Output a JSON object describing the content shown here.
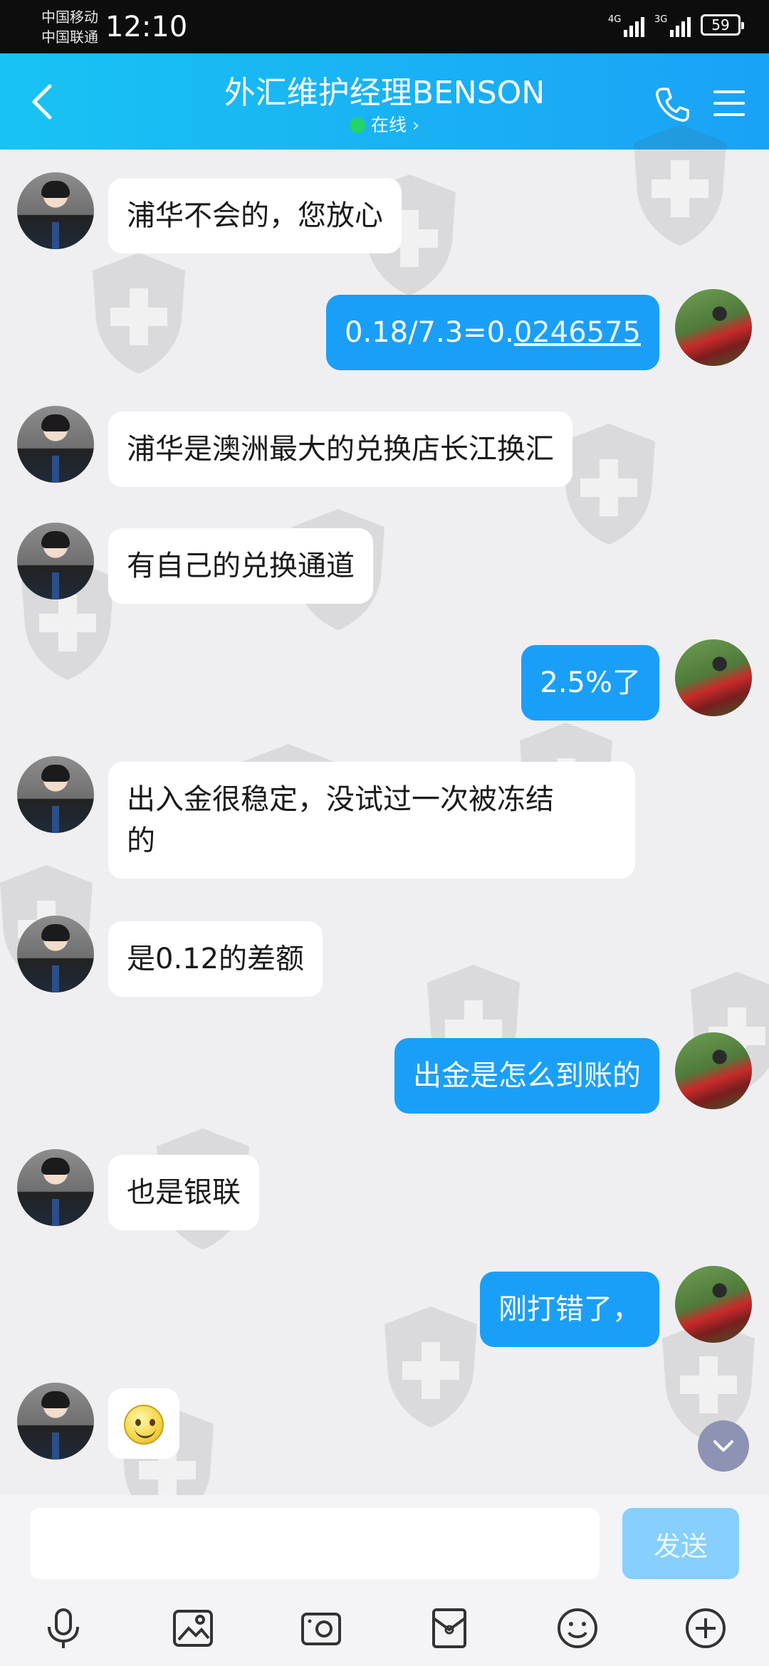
{
  "status_bar": {
    "carrier_1": "中国移动",
    "carrier_2": "中国联通",
    "time": "12:10",
    "network_1": "4G",
    "network_2": "3G",
    "battery": "59"
  },
  "header": {
    "title": "外汇维护经理BENSON",
    "status": "在线 ›"
  },
  "messages": [
    {
      "side": "in",
      "text": "浦华不会的，您放心"
    },
    {
      "side": "out",
      "text_plain": "0.18/7.3=0.",
      "text_link": "0246575"
    },
    {
      "side": "in",
      "text": "浦华是澳洲最大的兑换店长江换汇"
    },
    {
      "side": "in",
      "text": "有自己的兑换通道"
    },
    {
      "side": "out",
      "text": "2.5%了"
    },
    {
      "side": "in",
      "text_line1": "出入金很稳定，没试过一次被冻结",
      "text_line2": "的"
    },
    {
      "side": "in",
      "text": "是0.12的差额"
    },
    {
      "side": "out",
      "text": "出金是怎么到账的"
    },
    {
      "side": "in",
      "text": "也是银联"
    },
    {
      "side": "out",
      "text": "刚打错了，"
    },
    {
      "side": "in",
      "emoji": "smile-emoji"
    }
  ],
  "input": {
    "value": "",
    "send_label": "发送"
  },
  "toolbar_icons": [
    "microphone-icon",
    "image-icon",
    "camera-icon",
    "red-packet-icon",
    "emoji-icon",
    "plus-icon"
  ],
  "colors": {
    "header_start": "#18c3f3",
    "header_end": "#1aa2f6",
    "outgoing_bubble": "#1a9ff8",
    "incoming_bubble": "#ffffff",
    "online_dot": "#25d366",
    "send_button": "#86cfff"
  }
}
